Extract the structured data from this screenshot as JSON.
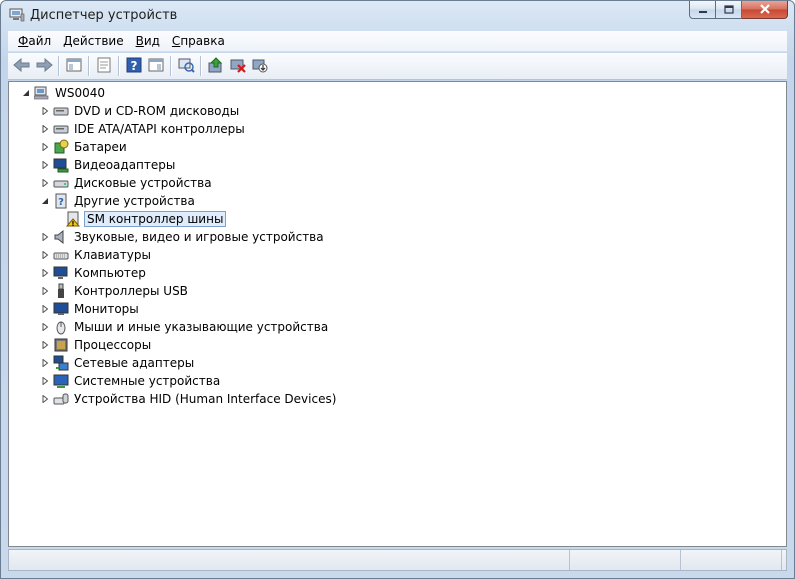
{
  "window": {
    "title": "Диспетчер устройств"
  },
  "menu": {
    "items": [
      {
        "label": "Файл",
        "accel": "Ф",
        "rest": "айл"
      },
      {
        "label": "Действие",
        "accel": "Д",
        "rest": "ействие"
      },
      {
        "label": "Вид",
        "accel": "В",
        "rest": "ид"
      },
      {
        "label": "Справка",
        "accel": "С",
        "rest": "правка"
      }
    ]
  },
  "toolbar": {
    "buttons": [
      "back-icon",
      "forward-icon",
      "show-hide-console-tree-icon",
      "properties-icon",
      "help-icon",
      "show-action-pane-icon",
      "scan-hardware-changes-icon",
      "update-driver-icon",
      "disable-device-icon",
      "uninstall-device-icon"
    ]
  },
  "tree": {
    "root": {
      "label": "WS0040",
      "icon": "computer-icon",
      "expanded": true
    },
    "items": [
      {
        "label": "DVD и CD-ROM дисководы",
        "icon": "dvd-drive-icon",
        "expanded": false
      },
      {
        "label": "IDE ATA/ATAPI контроллеры",
        "icon": "ide-controller-icon",
        "expanded": false
      },
      {
        "label": "Батареи",
        "icon": "battery-icon",
        "expanded": false
      },
      {
        "label": "Видеоадаптеры",
        "icon": "display-adapter-icon",
        "expanded": false
      },
      {
        "label": "Дисковые устройства",
        "icon": "disk-drive-icon",
        "expanded": false
      },
      {
        "label": "Другие устройства",
        "icon": "unknown-device-icon",
        "expanded": true,
        "children": [
          {
            "label": "SM контроллер шины",
            "icon": "warning-device-icon",
            "selected": true
          }
        ]
      },
      {
        "label": "Звуковые, видео и игровые устройства",
        "icon": "speaker-icon",
        "expanded": false
      },
      {
        "label": "Клавиатуры",
        "icon": "keyboard-icon",
        "expanded": false
      },
      {
        "label": "Компьютер",
        "icon": "computer-monitor-icon",
        "expanded": false
      },
      {
        "label": "Контроллеры USB",
        "icon": "usb-icon",
        "expanded": false
      },
      {
        "label": "Мониторы",
        "icon": "monitor-icon",
        "expanded": false
      },
      {
        "label": "Мыши и иные указывающие устройства",
        "icon": "mouse-icon",
        "expanded": false
      },
      {
        "label": "Процессоры",
        "icon": "processor-icon",
        "expanded": false
      },
      {
        "label": "Сетевые адаптеры",
        "icon": "network-adapter-icon",
        "expanded": false
      },
      {
        "label": "Системные устройства",
        "icon": "system-device-icon",
        "expanded": false
      },
      {
        "label": "Устройства HID (Human Interface Devices)",
        "icon": "hid-icon",
        "expanded": false
      }
    ]
  },
  "colors": {
    "selection_bg": "#dfecfb",
    "selection_border": "#7da2ce",
    "close_button": "#c74733"
  }
}
